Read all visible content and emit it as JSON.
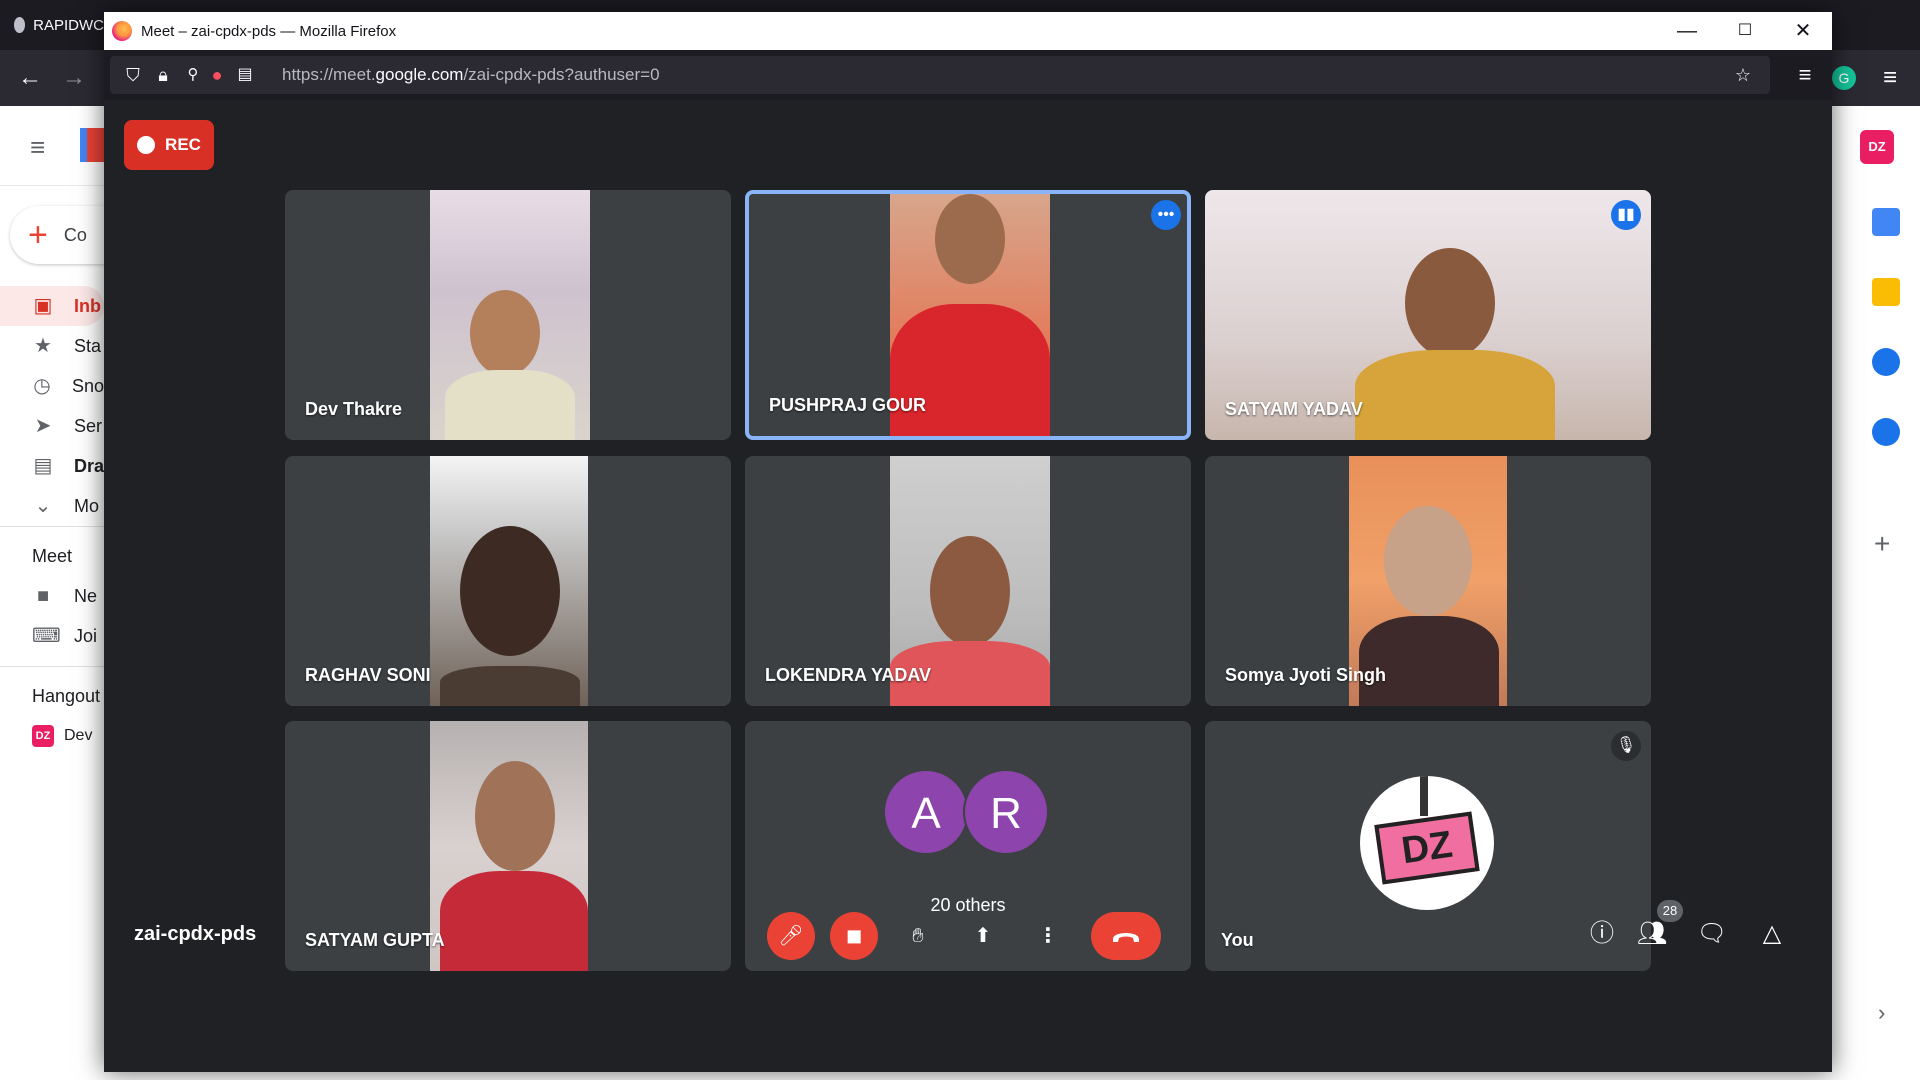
{
  "background_browser": {
    "tab_title": "RAPIDWC",
    "sidebar": [
      {
        "label": "Co",
        "icon": "compose-plus-icon"
      },
      {
        "label": "Inb",
        "icon": "inbox-icon",
        "active": true
      },
      {
        "label": "Sta",
        "icon": "star-icon"
      },
      {
        "label": "Sno",
        "icon": "clock-icon"
      },
      {
        "label": "Ser",
        "icon": "send-icon"
      },
      {
        "label": "Dra",
        "icon": "draft-icon"
      },
      {
        "label": "Mo",
        "icon": "chevron-down-icon"
      }
    ],
    "meet_section": "Meet",
    "meet_items": [
      {
        "label": "Ne",
        "icon": "video-icon"
      },
      {
        "label": "Joi",
        "icon": "keyboard-icon"
      }
    ],
    "hangouts_section": "Hangout",
    "hangouts_contact": "Dev"
  },
  "popup": {
    "window_title": "Meet – zai-cpdx-pds — Mozilla Firefox",
    "url_prefix": "https://meet.",
    "url_domain": "google.com",
    "url_path": "/zai-cpdx-pds?authuser=0"
  },
  "meet": {
    "rec_label": "REC",
    "meeting_code": "zai-cpdx-pds",
    "participants": [
      {
        "name": "Dev Thakre"
      },
      {
        "name": "PUSHPRAJ GOUR",
        "speaking": true,
        "badge": "more-options-icon"
      },
      {
        "name": "SATYAM YADAV",
        "badge": "audio-active-icon"
      },
      {
        "name": "RAGHAV SONI"
      },
      {
        "name": "LOKENDRA YADAV"
      },
      {
        "name": "Somya Jyoti Singh"
      },
      {
        "name": "SATYAM GUPTA"
      }
    ],
    "others": {
      "avatars": [
        "A",
        "R"
      ],
      "label": "20 others"
    },
    "self": {
      "name": "You",
      "muted": true
    },
    "people_count": "28",
    "colors": {
      "background": "#202124",
      "tile": "#3c4043",
      "red": "#ea4335",
      "speaking_border": "#8ab4f8",
      "avatar": "#8e44ad"
    }
  }
}
